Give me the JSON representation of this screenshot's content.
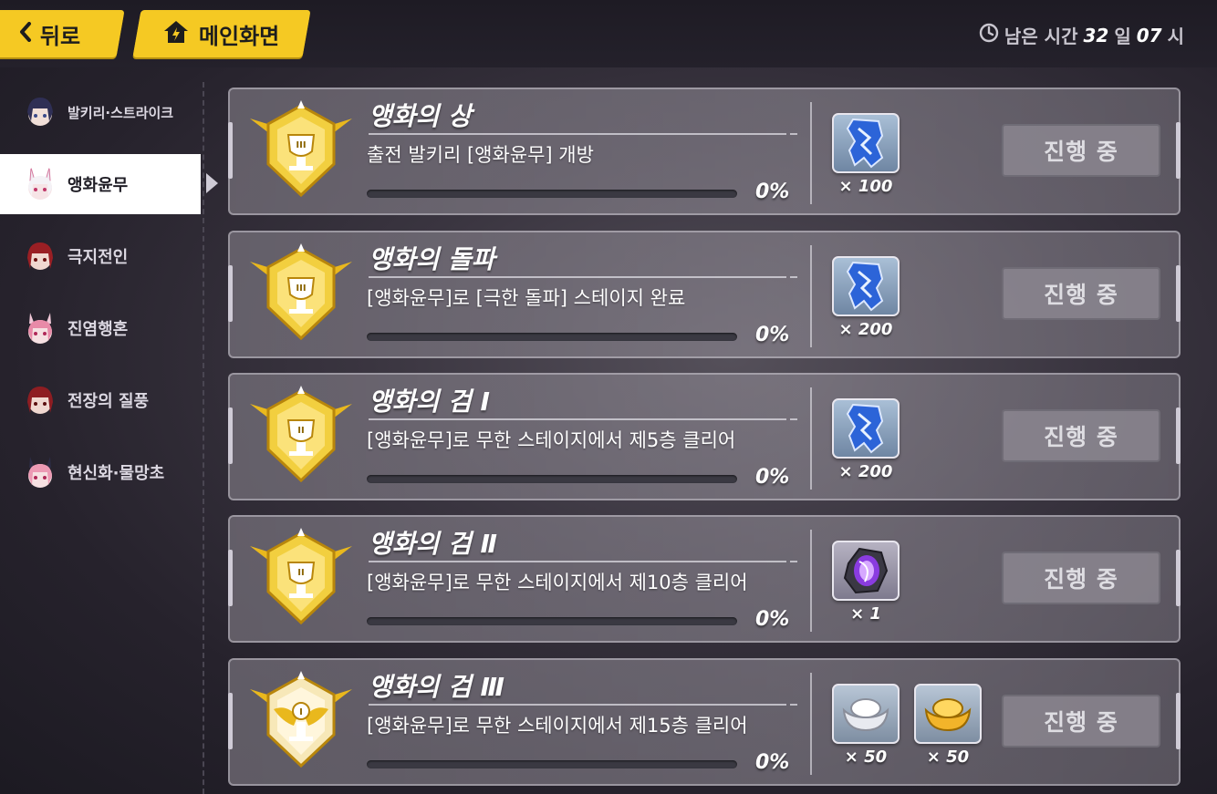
{
  "header": {
    "back_label": "뒤로",
    "home_label": "메인화면",
    "timer": {
      "prefix": "남은 시간",
      "days": "32",
      "days_unit": "일",
      "hours": "07",
      "hours_unit": "시"
    }
  },
  "sidebar": {
    "items": [
      {
        "label": "발키리·스트라이크",
        "active": false
      },
      {
        "label": "앵화윤무",
        "active": true
      },
      {
        "label": "극지전인",
        "active": false
      },
      {
        "label": "진염행혼",
        "active": false
      },
      {
        "label": "전장의 질풍",
        "active": false
      },
      {
        "label": "현신화·물망초",
        "active": false
      }
    ]
  },
  "missions": [
    {
      "title": "앵화의 상",
      "description": "출전 발키리 [앵화윤무] 개방",
      "progress_text": "0%",
      "progress": 0,
      "medal_rank": "III",
      "rewards": [
        {
          "icon": "crystal-shard-icon",
          "qty": "× 100"
        }
      ],
      "status": "진행 중"
    },
    {
      "title": "앵화의 돌파",
      "description": "[앵화윤무]로 [극한 돌파] 스테이지 완료",
      "progress_text": "0%",
      "progress": 0,
      "medal_rank": "III",
      "rewards": [
        {
          "icon": "crystal-shard-icon",
          "qty": "× 200"
        }
      ],
      "status": "진행 중"
    },
    {
      "title": "앵화의 검 Ⅰ",
      "description": "[앵화윤무]로 무한 스테이지에서 제5층 클리어",
      "progress_text": "0%",
      "progress": 0,
      "medal_rank": "II",
      "rewards": [
        {
          "icon": "crystal-shard-icon",
          "qty": "× 200"
        }
      ],
      "status": "진행 중"
    },
    {
      "title": "앵화의 검 Ⅱ",
      "description": "[앵화윤무]로 무한 스테이지에서 제10층 클리어",
      "progress_text": "0%",
      "progress": 0,
      "medal_rank": "II",
      "rewards": [
        {
          "icon": "purple-core-icon",
          "qty": "× 1"
        }
      ],
      "status": "진행 중"
    },
    {
      "title": "앵화의 검 Ⅲ",
      "description": "[앵화윤무]로 무한 스테이지에서 제15층 클리어",
      "progress_text": "0%",
      "progress": 0,
      "medal_rank": "I",
      "rewards": [
        {
          "icon": "silver-ingot-icon",
          "qty": "× 50"
        },
        {
          "icon": "gold-ingot-icon",
          "qty": "× 50"
        }
      ],
      "status": "진행 중"
    }
  ],
  "colors": {
    "accent": "#f5c923",
    "gold": "#e9b81d",
    "status_button": "#8c8891"
  }
}
